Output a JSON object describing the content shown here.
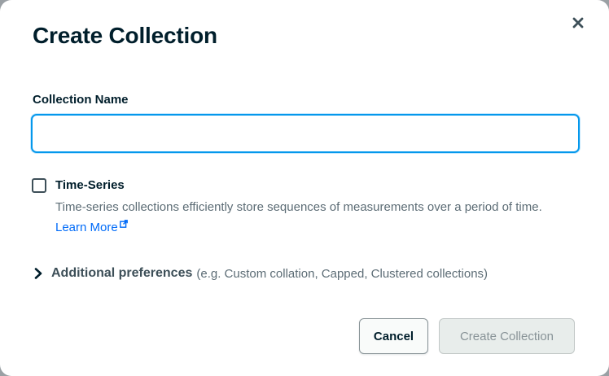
{
  "dialog": {
    "title": "Create Collection",
    "close_icon": "close-icon"
  },
  "collection_name": {
    "label": "Collection Name",
    "value": "",
    "placeholder": ""
  },
  "time_series": {
    "label": "Time-Series",
    "checked": false,
    "description": "Time-series collections efficiently store sequences of measurements over a period of time.",
    "link_label": "Learn More",
    "link_icon": "external-link-icon"
  },
  "additional_preferences": {
    "icon": "chevron-right-icon",
    "title": "Additional preferences",
    "hint": "(e.g. Custom collation, Capped, Clustered collections)"
  },
  "footer": {
    "cancel_label": "Cancel",
    "create_label": "Create Collection",
    "create_disabled": true
  },
  "colors": {
    "focus_border": "#0498ec",
    "link": "#016bf8",
    "heading": "#001e2b",
    "muted_text": "#5c6c75"
  }
}
